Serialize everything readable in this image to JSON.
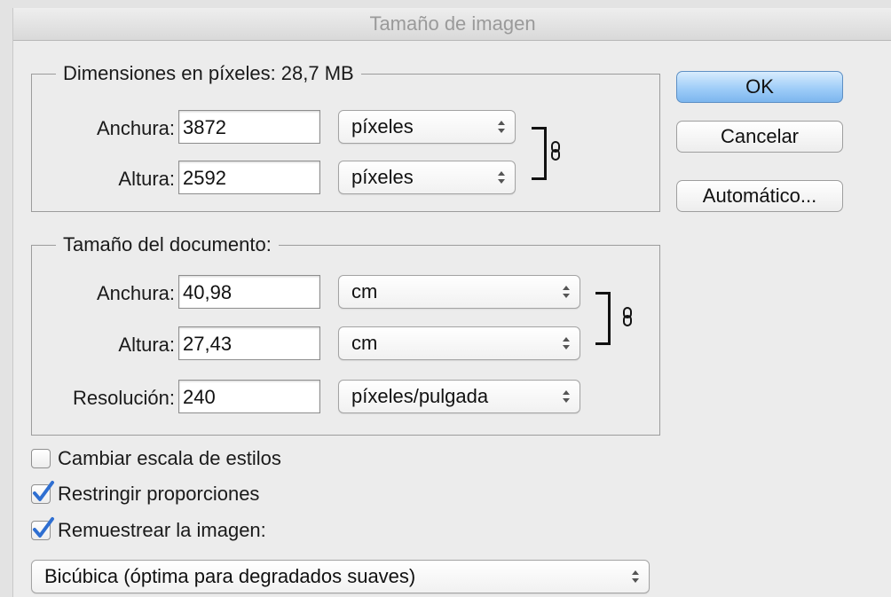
{
  "window": {
    "title": "Tamaño de imagen"
  },
  "pixel_dimensions": {
    "legend": "Dimensiones en píxeles: 28,7 MB",
    "width": {
      "label": "Anchura:",
      "value": "3872",
      "unit": "píxeles"
    },
    "height": {
      "label": "Altura:",
      "value": "2592",
      "unit": "píxeles"
    }
  },
  "document_size": {
    "legend": "Tamaño del documento:",
    "width": {
      "label": "Anchura:",
      "value": "40,98",
      "unit": "cm"
    },
    "height": {
      "label": "Altura:",
      "value": "27,43",
      "unit": "cm"
    },
    "resolution": {
      "label": "Resolución:",
      "value": "240",
      "unit": "píxeles/pulgada"
    }
  },
  "buttons": {
    "ok": "OK",
    "cancel": "Cancelar",
    "auto": "Automático..."
  },
  "options": {
    "scale_styles": {
      "label": "Cambiar escala de estilos",
      "checked": false
    },
    "constrain": {
      "label": "Restringir proporciones",
      "checked": true
    },
    "resample": {
      "label": "Remuestrear la imagen:",
      "checked": true
    }
  },
  "resample_method": {
    "value": "Bicúbica (óptima para degradados suaves)"
  },
  "icons": {
    "chain": "chain-link-icon",
    "arrows": "updown-arrows-icon",
    "check": "checkmark-icon"
  },
  "colors": {
    "default_button": "#9fcdf8",
    "check": "#2f6fd1"
  }
}
